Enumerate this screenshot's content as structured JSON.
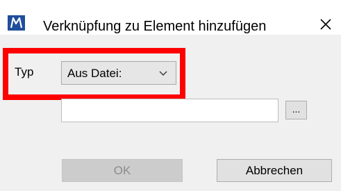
{
  "window": {
    "title": "Verknüpfung zu Element hinzufügen",
    "app_icon": "microstation-logo-icon",
    "close_icon": "close-icon"
  },
  "form": {
    "type_label": "Typ",
    "type_select": {
      "value": "Aus Datei:",
      "icon": "chevron-down-icon"
    },
    "file_path": {
      "value": "",
      "placeholder": ""
    },
    "browse_label": "..."
  },
  "buttons": {
    "ok_label": "OK",
    "ok_enabled": false,
    "cancel_label": "Abbrechen"
  },
  "annotation": {
    "highlight_color": "#ff0000"
  },
  "colors": {
    "dialog_background": "#f0f0f0",
    "titlebar_background": "#ffffff",
    "app_icon_blue": "#1f4e9c"
  }
}
